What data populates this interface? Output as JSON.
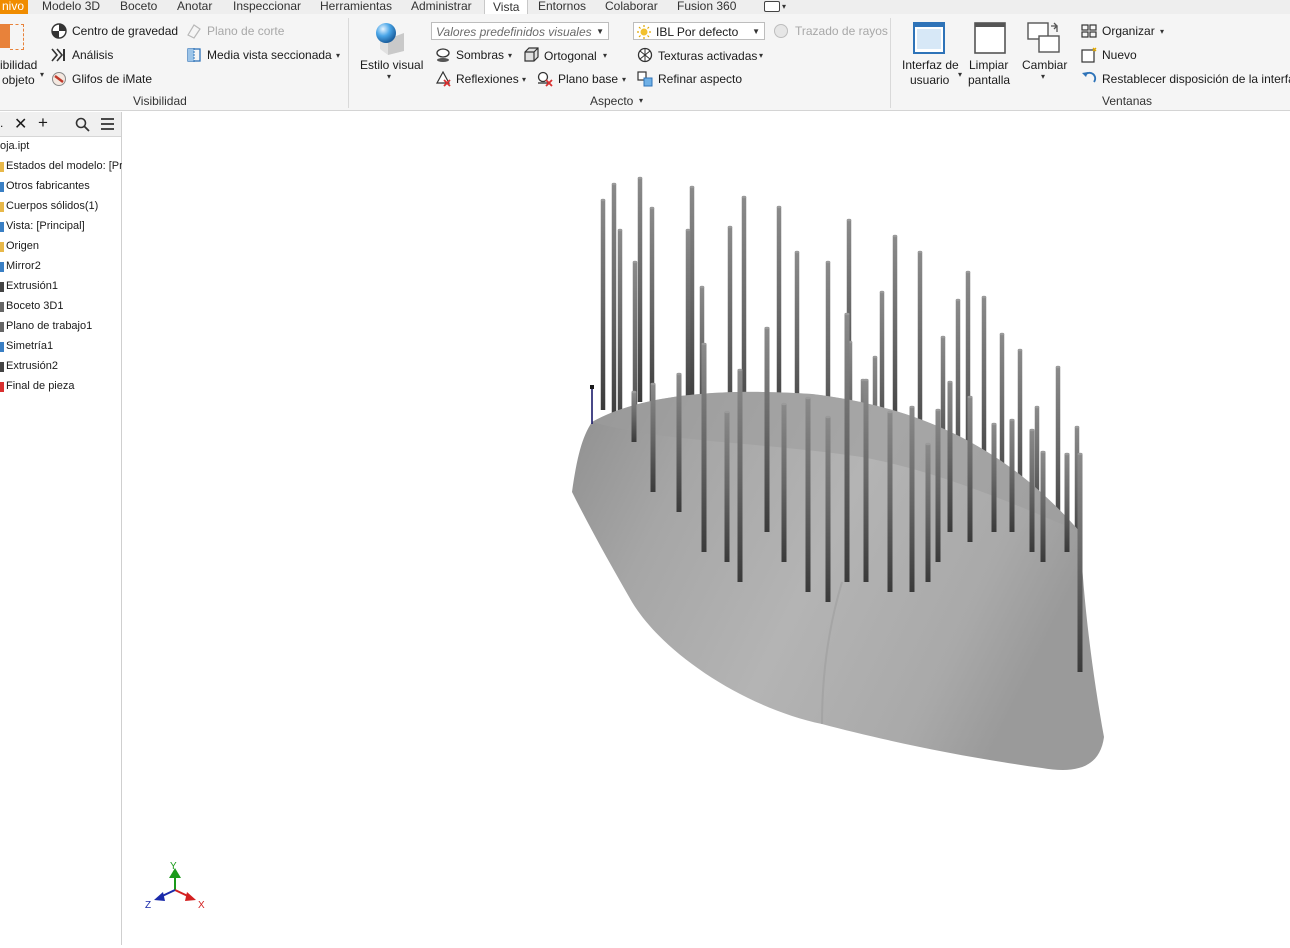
{
  "tabs": [
    {
      "label": "nivo",
      "kind": "file"
    },
    {
      "label": "Modelo 3D"
    },
    {
      "label": "Boceto"
    },
    {
      "label": "Anotar"
    },
    {
      "label": "Inspeccionar"
    },
    {
      "label": "Herramientas"
    },
    {
      "label": "Administrar"
    },
    {
      "label": "Vista",
      "active": true
    },
    {
      "label": "Entornos"
    },
    {
      "label": "Colaborar"
    },
    {
      "label": "Fusion 360"
    }
  ],
  "ribbon": {
    "visibility": {
      "big_label_1": "ibilidad",
      "big_label_2": "objeto",
      "center_gravity": "Centro de gravedad",
      "analysis": "Análisis",
      "imate": "Glifos de iMate",
      "section_plane": "Plano de corte",
      "half_section": "Media vista seccionada",
      "panel": "Visibilidad"
    },
    "appearance": {
      "visual_style": "Estilo visual",
      "presets_placeholder": "Valores predefinidos visuales",
      "shadows": "Sombras",
      "orthographic": "Ortogonal",
      "reflections": "Reflexiones",
      "ground_plane": "Plano base",
      "ibl": "IBL Por defecto",
      "textures": "Texturas activadas",
      "refine": "Refinar aspecto",
      "ray_tracing": "Trazado de rayos",
      "panel": "Aspecto"
    },
    "windows": {
      "ui_1": "Interfaz de",
      "ui_2": "usuario",
      "clean_1": "Limpiar",
      "clean_2": "pantalla",
      "switch": "Cambiar",
      "arrange": "Organizar",
      "new": "Nuevo",
      "reset": "Restablecer disposición de la interfa",
      "panel": "Ventanas"
    }
  },
  "browser": {
    "head_truncated": ".",
    "file": "oja.ipt",
    "nodes": [
      {
        "label": "Estados del modelo: [Pri",
        "color": "#e8b84a"
      },
      {
        "label": "Otros fabricantes",
        "color": "#3a7fc4"
      },
      {
        "label": "Cuerpos sólidos(1)",
        "color": "#e8b84a"
      },
      {
        "label": "Vista: [Principal]",
        "color": "#3a7fc4"
      },
      {
        "label": "Origen",
        "color": "#e8b84a"
      },
      {
        "label": "Mirror2",
        "color": "#3a7fc4"
      },
      {
        "label": "Extrusión1",
        "color": "#444444"
      },
      {
        "label": "Boceto 3D1",
        "color": "#666666"
      },
      {
        "label": "Plano de trabajo1",
        "color": "#666666"
      },
      {
        "label": "Simetría1",
        "color": "#3a7fc4"
      },
      {
        "label": "Extrusión2",
        "color": "#444444"
      },
      {
        "label": "Final de pieza",
        "color": "#d93030"
      }
    ]
  },
  "axes": {
    "y": "Y",
    "x": "X",
    "z": "Z"
  },
  "colors": {
    "file_tab": "#f08c00",
    "accent": "#2e73b8"
  }
}
